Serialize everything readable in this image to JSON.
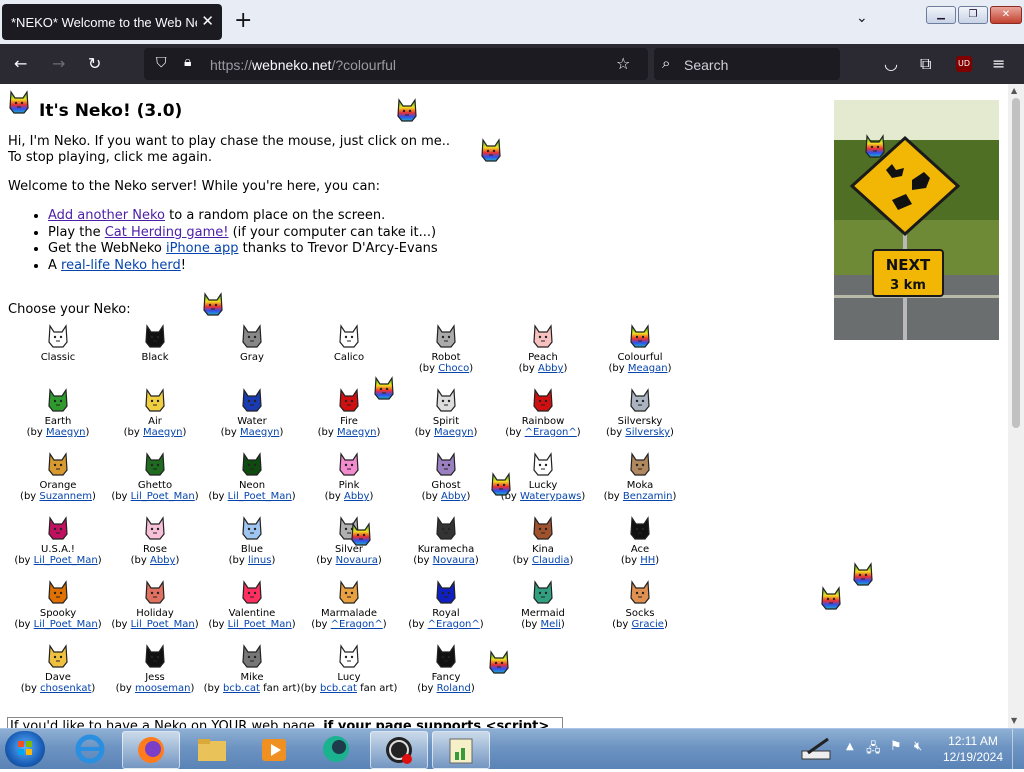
{
  "browser": {
    "tab_title": "*NEKO* Welcome to the Web Neko Server",
    "url_prefix": "https://",
    "url_host": "webneko.net",
    "url_path": "/?colourful",
    "search_placeholder": "Search",
    "extension_badge": "UD"
  },
  "page": {
    "heading": "It's Neko! (3.0)",
    "intro_line1": "Hi, I'm Neko. If you want to play chase the mouse, just click on me..",
    "intro_line2": "To stop playing, click me again.",
    "welcome": "Welcome to the Neko server! While you're here, you can:",
    "actions": {
      "add_link": "Add another Neko",
      "add_text": " to a random place on the screen.",
      "play_pre": "Play the ",
      "play_link": "Cat Herding game!",
      "play_post": " (if your computer can take it...)",
      "get_pre": "Get the WebNeko ",
      "get_link": "iPhone app",
      "get_post": " thanks to Trevor D'Arcy-Evans",
      "herd_pre": "A ",
      "herd_link": "real-life Neko herd",
      "herd_post": "!"
    },
    "choose_label": "Choose your Neko:",
    "nekos": [
      {
        "name": "Classic",
        "by": "",
        "color": "#ffffff"
      },
      {
        "name": "Black",
        "by": "",
        "color": "#111111"
      },
      {
        "name": "Gray",
        "by": "",
        "color": "#888888"
      },
      {
        "name": "Calico",
        "by": "",
        "color": "#ffffff"
      },
      {
        "name": "Robot",
        "by": "Choco",
        "color": "#aaaaaa"
      },
      {
        "name": "Peach",
        "by": "Abby",
        "color": "#f6c1bf"
      },
      {
        "name": "Colourful",
        "by": "Meagan",
        "color": "#3fbf3f"
      },
      {
        "name": "Earth",
        "by": "Maegyn",
        "color": "#2e9a2e"
      },
      {
        "name": "Air",
        "by": "Maegyn",
        "color": "#f0d040"
      },
      {
        "name": "Water",
        "by": "Maegyn",
        "color": "#1a3ab0"
      },
      {
        "name": "Fire",
        "by": "Maegyn",
        "color": "#d01010"
      },
      {
        "name": "Spirit",
        "by": "Maegyn",
        "color": "#dddddd"
      },
      {
        "name": "Rainbow",
        "by": "^Eragon^",
        "color": "#d01010"
      },
      {
        "name": "Silversky",
        "by": "Silversky",
        "color": "#aab4c0"
      },
      {
        "name": "Orange",
        "by": "Suzannem",
        "color": "#d89a30"
      },
      {
        "name": "Ghetto",
        "by": "Lil_Poet_Man",
        "color": "#1f6b1f"
      },
      {
        "name": "Neon",
        "by": "Lil_Poet_Man",
        "color": "#0f4a0f"
      },
      {
        "name": "Pink",
        "by": "Abby",
        "color": "#f28ccf"
      },
      {
        "name": "Ghost",
        "by": "Abby",
        "color": "#9a80c0"
      },
      {
        "name": "Lucky",
        "by": "Waterypaws",
        "color": "#ffffff"
      },
      {
        "name": "Moka",
        "by": "Benzamin",
        "color": "#b08860"
      },
      {
        "name": "U.S.A.!",
        "by": "Lil_Poet_Man",
        "color": "#c01060"
      },
      {
        "name": "Rose",
        "by": "Abby",
        "color": "#f5c0d8"
      },
      {
        "name": "Blue",
        "by": "linus",
        "color": "#9fc6f0"
      },
      {
        "name": "Silver",
        "by": "Novaura",
        "color": "#b0b0b0"
      },
      {
        "name": "Kuramecha",
        "by": "Novaura",
        "color": "#333333"
      },
      {
        "name": "Kina",
        "by": "Claudia",
        "color": "#a0522d"
      },
      {
        "name": "Ace",
        "by": "HH",
        "color": "#111111"
      },
      {
        "name": "Spooky",
        "by": "Lil_Poet_Man",
        "color": "#e07000"
      },
      {
        "name": "Holiday",
        "by": "Lil_Poet_Man",
        "color": "#e07060"
      },
      {
        "name": "Valentine",
        "by": "Lil_Poet_Man",
        "color": "#ff3060"
      },
      {
        "name": "Marmalade",
        "by": "^Eragon^",
        "color": "#e8a040"
      },
      {
        "name": "Royal",
        "by": "^Eragon^",
        "color": "#1020c0"
      },
      {
        "name": "Mermaid",
        "by": "Meli",
        "color": "#30a080"
      },
      {
        "name": "Socks",
        "by": "Gracie",
        "color": "#e09050"
      },
      {
        "name": "Dave",
        "by": "chosenkat",
        "color": "#f0c040"
      },
      {
        "name": "Jess",
        "by": "mooseman",
        "color": "#111111"
      },
      {
        "name": "Mike",
        "by": "bcb.cat",
        "by_suffix": " fan art",
        "color": "#777777"
      },
      {
        "name": "Lucy",
        "by": "bcb.cat",
        "by_suffix": " fan art",
        "color": "#ffffff"
      },
      {
        "name": "Fancy",
        "by": "Roland",
        "color": "#111111"
      }
    ],
    "bottom_text_pre": "If you'd like to have a Neko on YOUR web page, ",
    "bottom_text_bold": "if your page supports <script>"
  },
  "sign": {
    "line1": "NEXT",
    "line2": "3 km"
  },
  "taskbar": {
    "time": "12:11 AM",
    "date": "12/19/2024"
  },
  "colors": {
    "chrome_dark": "#2b2a33",
    "tab_dark": "#1c1b22",
    "link_purple": "#4b1ea8",
    "link_blue": "#0645ad",
    "sign_yellow": "#f2b705"
  }
}
